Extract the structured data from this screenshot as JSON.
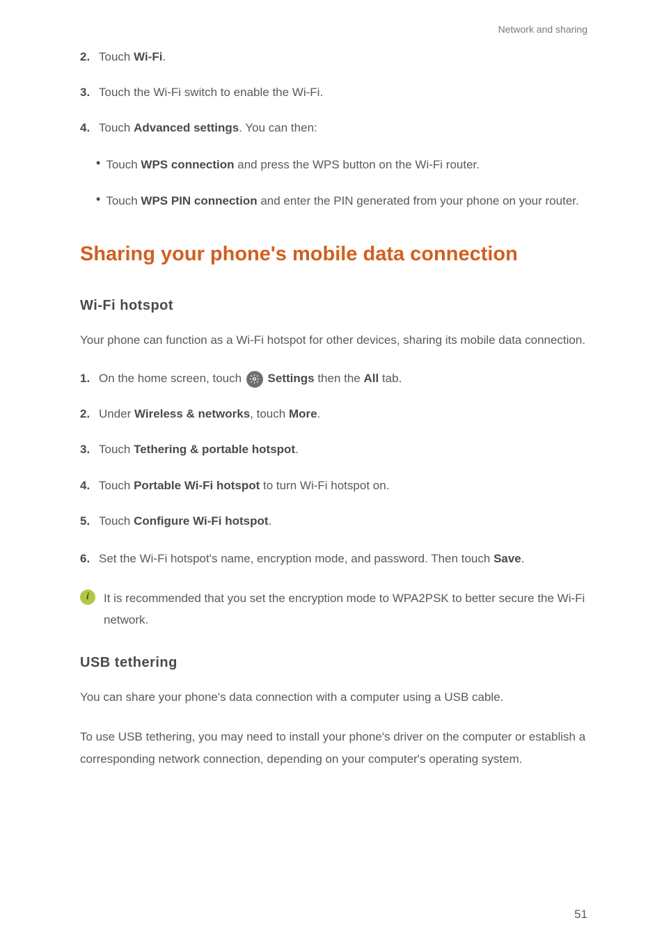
{
  "header": {
    "section_label": "Network and sharing"
  },
  "steps_a": {
    "s2": {
      "num": "2.",
      "prefix": "Touch ",
      "bold": "Wi-Fi",
      "suffix": "."
    },
    "s3": {
      "num": "3.",
      "text": "Touch the Wi-Fi switch to enable the Wi-Fi."
    },
    "s4": {
      "num": "4.",
      "prefix": "Touch ",
      "bold": "Advanced settings",
      "suffix": ". You can then:"
    },
    "bullet1": {
      "prefix": "Touch ",
      "bold": "WPS connection",
      "suffix": " and press the WPS button on the Wi-Fi router."
    },
    "bullet2": {
      "prefix": "Touch ",
      "bold": "WPS PIN connection",
      "suffix": " and enter the PIN generated from your phone on your router."
    }
  },
  "heading1": "Sharing your phone's mobile data connection",
  "subheading1": "Wi-Fi  hotspot",
  "para1": "Your phone can function as a Wi-Fi hotspot for other devices, sharing its mobile data connection.",
  "steps_b": {
    "s1": {
      "num": "1.",
      "prefix": "On the home screen, touch  ",
      "bold1": "Settings",
      "mid": " then the ",
      "bold2": "All",
      "suffix": " tab."
    },
    "s2": {
      "num": "2.",
      "prefix": "Under ",
      "bold1": "Wireless & networks",
      "mid": ", touch ",
      "bold2": "More",
      "suffix": "."
    },
    "s3": {
      "num": "3.",
      "prefix": "Touch ",
      "bold": "Tethering & portable hotspot",
      "suffix": "."
    },
    "s4": {
      "num": "4.",
      "prefix": "Touch ",
      "bold": "Portable Wi-Fi hotspot",
      "suffix": " to turn Wi-Fi hotspot on."
    },
    "s5": {
      "num": "5.",
      "prefix": "Touch ",
      "bold": "Configure Wi-Fi hotspot",
      "suffix": "."
    },
    "s6": {
      "num": "6.",
      "prefix": "Set the Wi-Fi hotspot's name, encryption mode, and password. Then touch ",
      "bold": "Save",
      "suffix": "."
    }
  },
  "info_note": "It is recommended that you set the encryption mode to WPA2PSK to better secure the Wi-Fi network.",
  "subheading2": "USB  tethering",
  "para2": "You can share your phone's data connection with a computer using a USB cable.",
  "para3": "To use USB tethering, you may need to install your phone's driver on the computer or establish a corresponding network connection, depending on your computer's operating system.",
  "page_number": "51"
}
